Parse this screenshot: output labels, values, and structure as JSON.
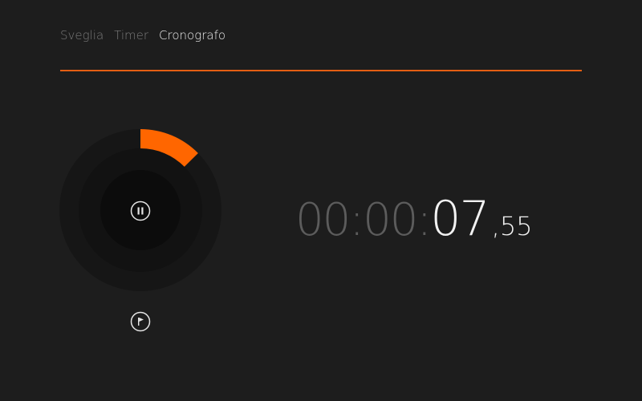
{
  "tabs": [
    {
      "label": "Sveglia",
      "active": false
    },
    {
      "label": "Timer",
      "active": false
    },
    {
      "label": "Cronografo",
      "active": true
    }
  ],
  "stopwatch": {
    "hours": "00",
    "minutes": "00",
    "seconds": "07",
    "separator": ":",
    "fraction": ",55",
    "progress_fraction": 0.126
  },
  "controls": {
    "pause_icon": "pause-icon",
    "lap_icon": "flag-icon"
  },
  "colors": {
    "background": "#1d1d1d",
    "accent": "#ff6600",
    "divider": "#e45e13",
    "text_active": "#ececec",
    "text_inactive": "#7b7b7b",
    "time_dim": "#5c5c5c"
  }
}
